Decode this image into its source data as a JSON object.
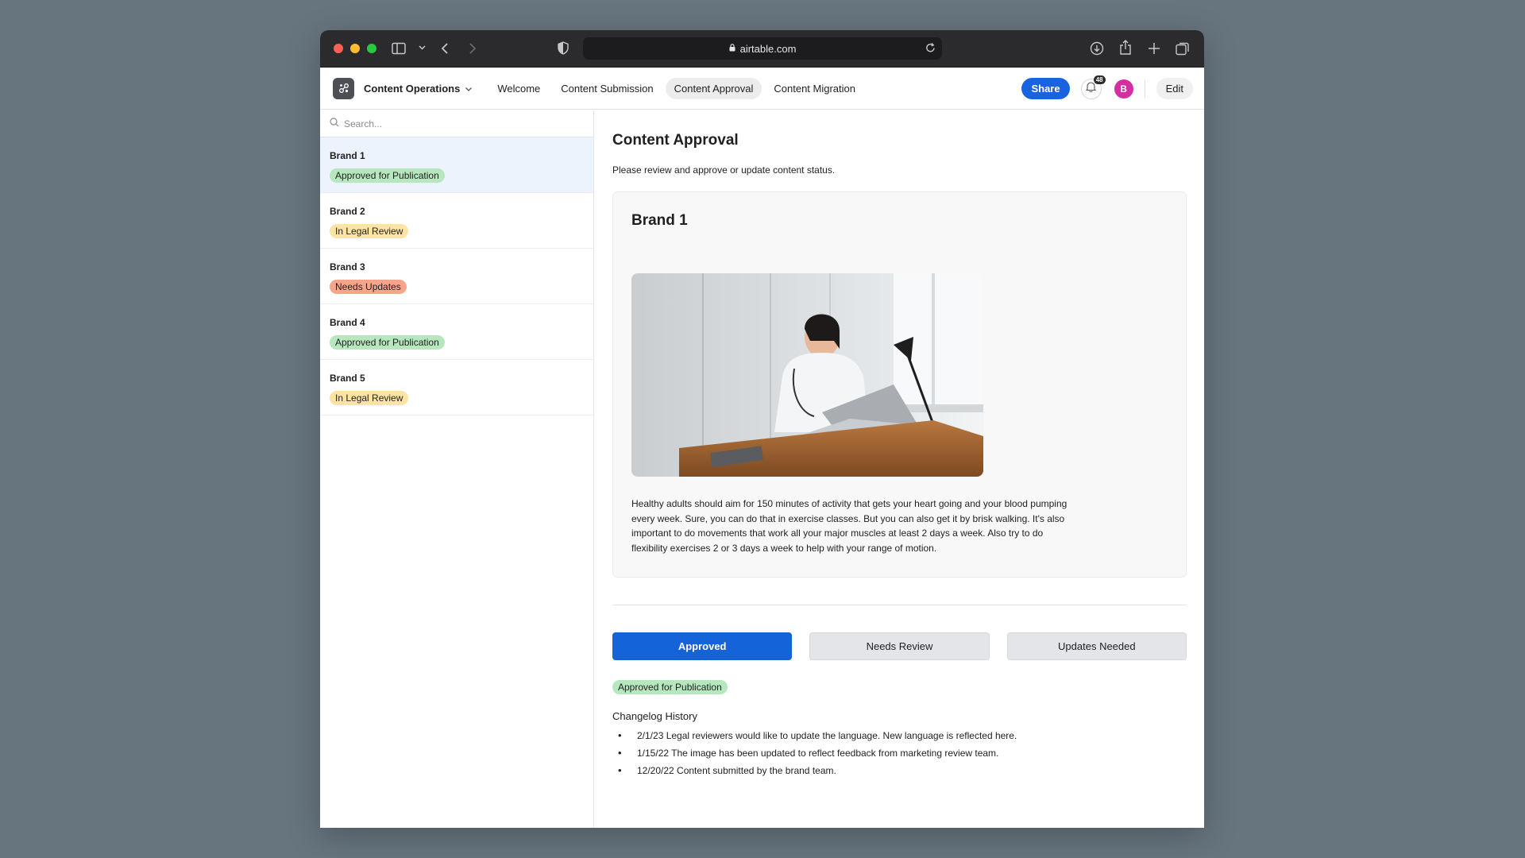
{
  "browser": {
    "url": "airtable.com",
    "traffic": {
      "close": "#fe5f57",
      "minimize": "#febc2e",
      "maximize": "#28c840"
    }
  },
  "appbar": {
    "base_name": "Content Operations",
    "tabs": [
      {
        "label": "Welcome",
        "active": false
      },
      {
        "label": "Content Submission",
        "active": false
      },
      {
        "label": "Content Approval",
        "active": true
      },
      {
        "label": "Content Migration",
        "active": false
      }
    ],
    "share_label": "Share",
    "notification_count": "48",
    "avatar_initial": "B",
    "edit_label": "Edit"
  },
  "sidebar": {
    "search_placeholder": "Search...",
    "items": [
      {
        "name": "Brand 1",
        "status": "Approved for Publication",
        "status_color": "#b7e7be",
        "selected": true
      },
      {
        "name": "Brand 2",
        "status": "In Legal Review",
        "status_color": "#fde4a3",
        "selected": false
      },
      {
        "name": "Brand 3",
        "status": "Needs Updates",
        "status_color": "#f7a58a",
        "selected": false
      },
      {
        "name": "Brand 4",
        "status": "Approved for Publication",
        "status_color": "#b7e7be",
        "selected": false
      },
      {
        "name": "Brand 5",
        "status": "In Legal Review",
        "status_color": "#fde4a3",
        "selected": false
      }
    ]
  },
  "main": {
    "title": "Content Approval",
    "description": "Please review and approve or update content status.",
    "card": {
      "title": "Brand 1",
      "body": "Healthy adults should aim for 150 minutes of activity that gets your heart going and your blood pumping every week. Sure, you can do that in exercise classes. But you can also get it by brisk walking. It's also important to do movements that work all your major muscles at least 2 days a week. Also try to do flexibility exercises 2 or 3 days a week to help with your range of motion."
    },
    "buttons": {
      "approved": "Approved",
      "needs_review": "Needs Review",
      "updates_needed": "Updates Needed"
    },
    "status": "Approved for Publication",
    "changelog_title": "Changelog History",
    "changelog": [
      "2/1/23 Legal reviewers would like to update the language. New language is reflected here.",
      "1/15/22 The image has been updated to reflect feedback from marketing review team.",
      "12/20/22 Content submitted by the brand team."
    ]
  }
}
